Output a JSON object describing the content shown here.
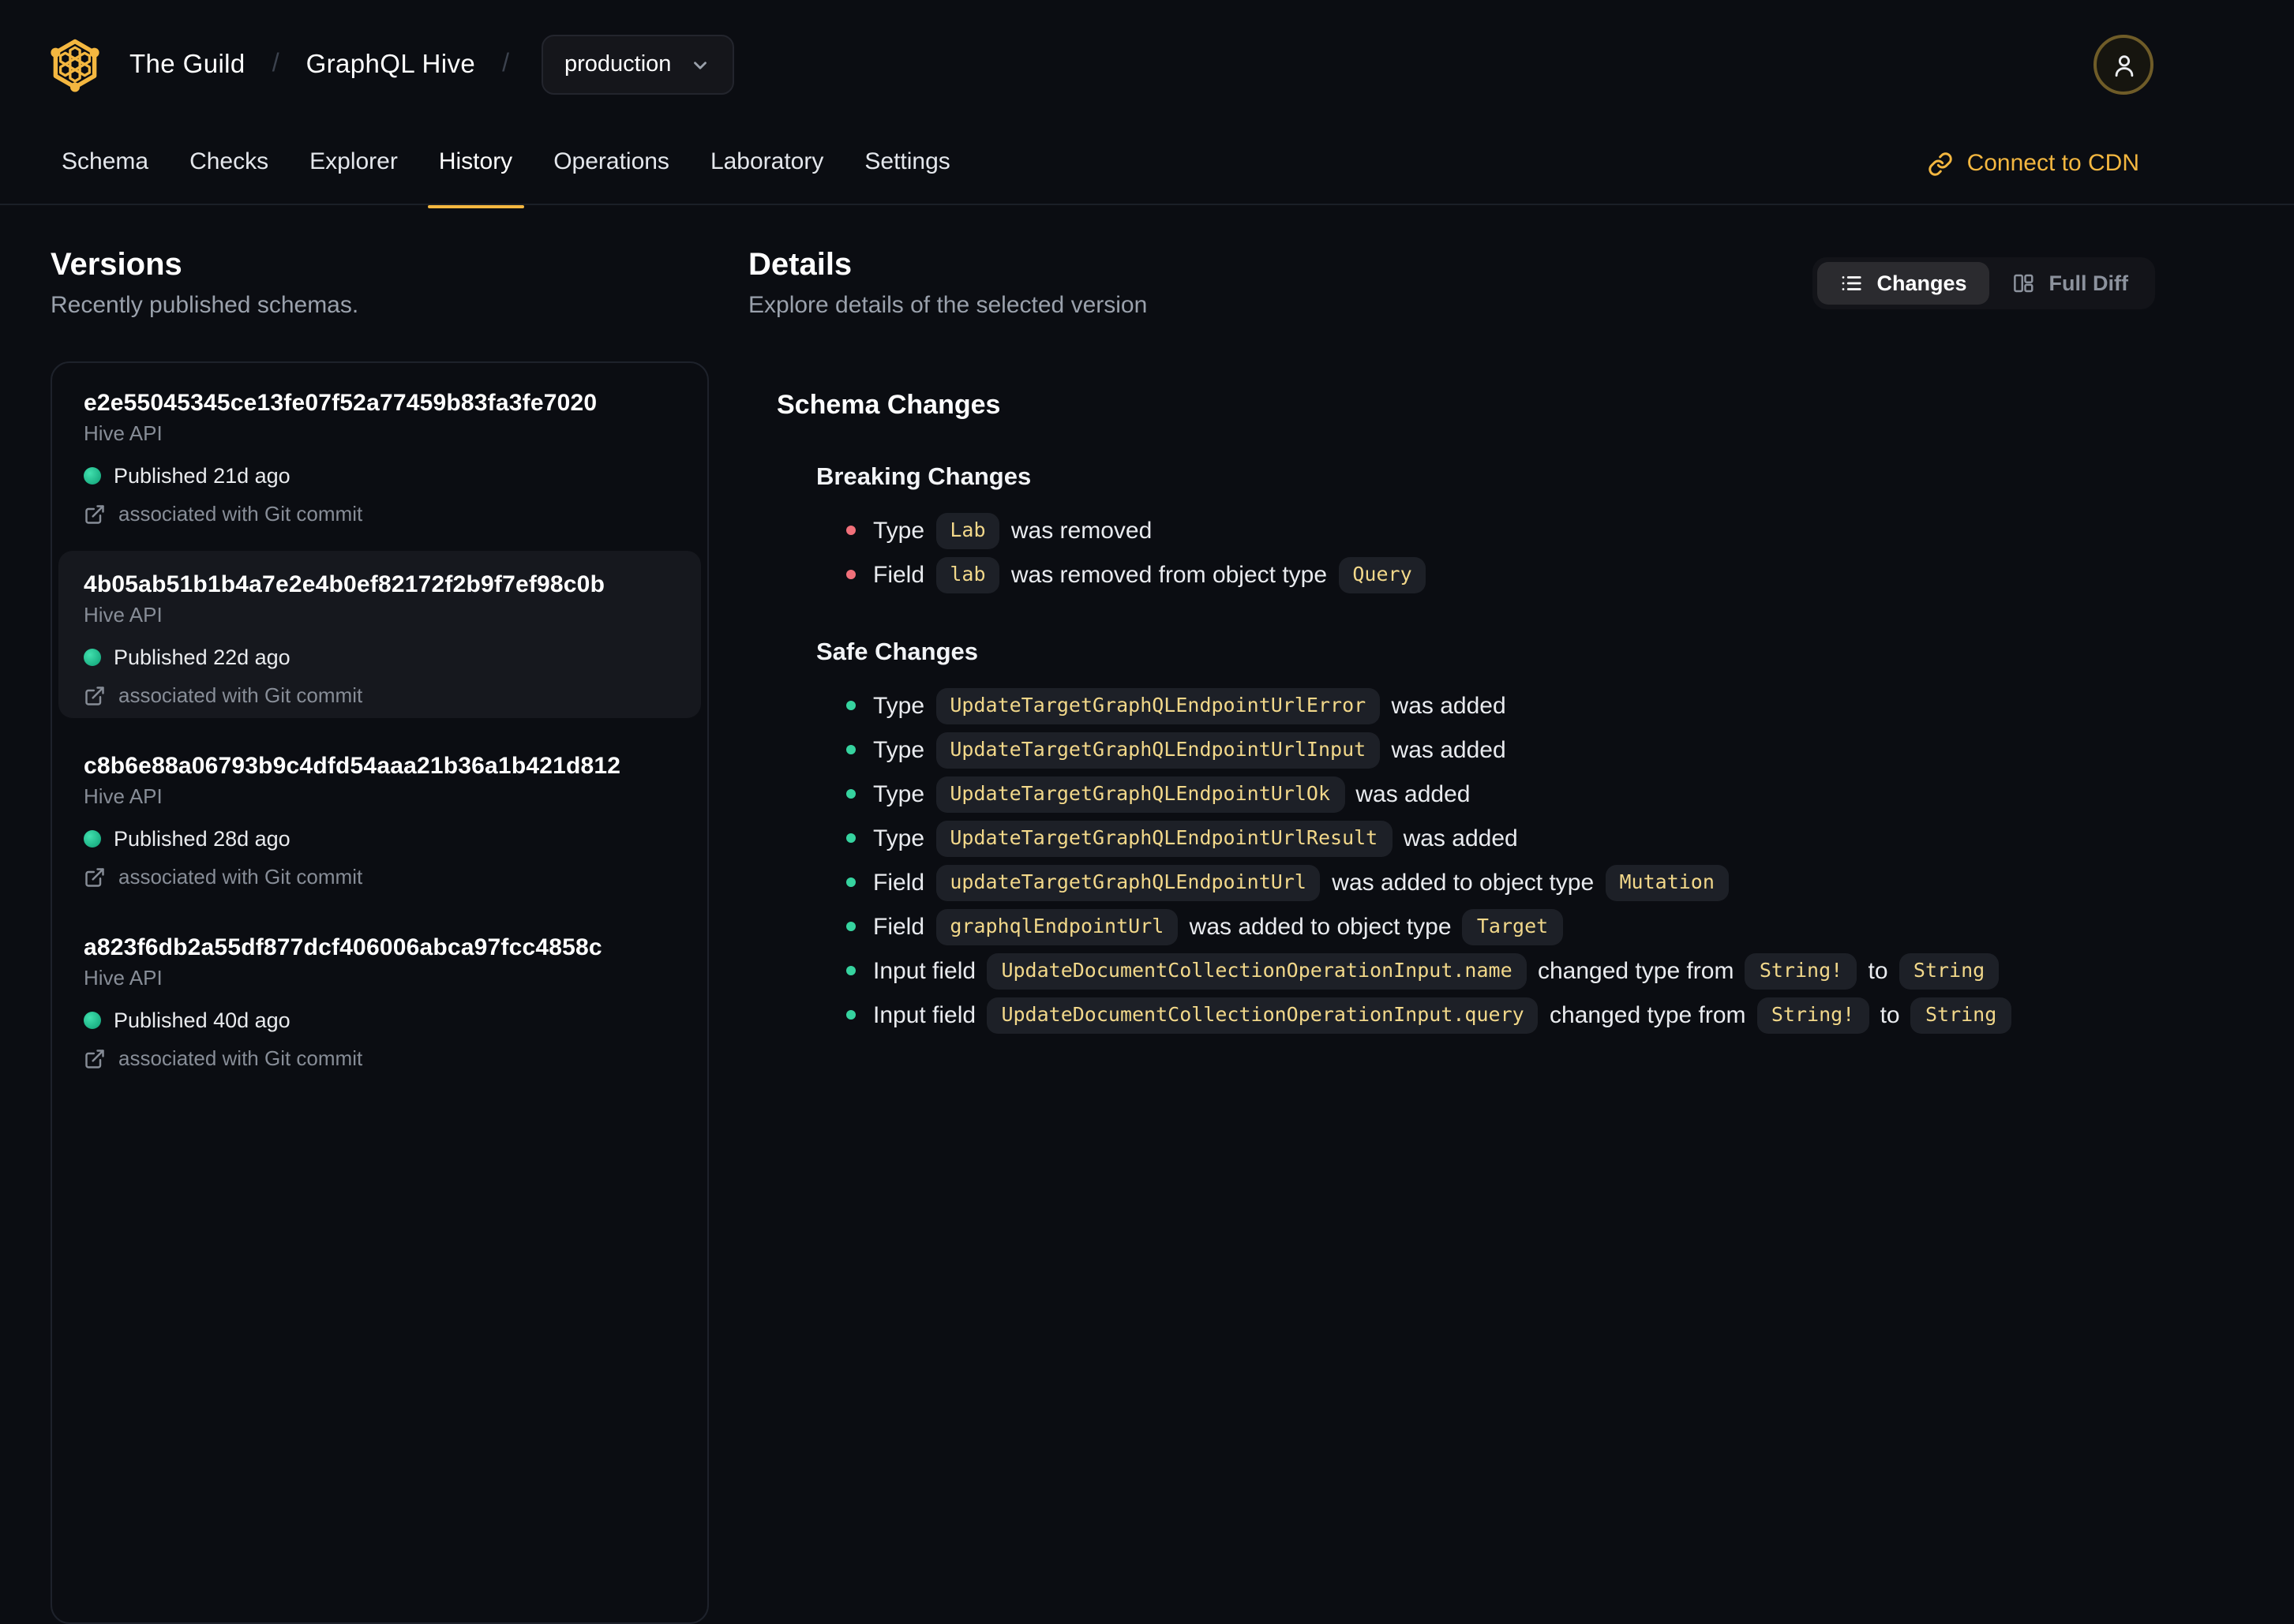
{
  "colors": {
    "accent": "#f4b740",
    "code_text": "#f2d88a",
    "breaking_bullet": "#f1707a",
    "safe_bullet": "#36d39f",
    "published_dot": "#10b981",
    "background": "#0b0d12"
  },
  "brand": {
    "org": "The Guild",
    "product": "GraphQL Hive",
    "environment": "production"
  },
  "nav": {
    "tabs": [
      {
        "label": "Schema",
        "active": false
      },
      {
        "label": "Checks",
        "active": false
      },
      {
        "label": "Explorer",
        "active": false
      },
      {
        "label": "History",
        "active": true
      },
      {
        "label": "Operations",
        "active": false
      },
      {
        "label": "Laboratory",
        "active": false
      },
      {
        "label": "Settings",
        "active": false
      }
    ],
    "cdn_link": "Connect to CDN"
  },
  "versions": {
    "title": "Versions",
    "subtitle": "Recently published schemas.",
    "items": [
      {
        "hash": "e2e55045345ce13fe07f52a77459b83fa3fe7020",
        "service": "Hive API",
        "published": "Published 21d ago",
        "git_note": "associated with Git commit",
        "selected": false
      },
      {
        "hash": "4b05ab51b1b4a7e2e4b0ef82172f2b9f7ef98c0b",
        "service": "Hive API",
        "published": "Published 22d ago",
        "git_note": "associated with Git commit",
        "selected": true
      },
      {
        "hash": "c8b6e88a06793b9c4dfd54aaa21b36a1b421d812",
        "service": "Hive API",
        "published": "Published 28d ago",
        "git_note": "associated with Git commit",
        "selected": false
      },
      {
        "hash": "a823f6db2a55df877dcf406006abca97fcc4858c",
        "service": "Hive API",
        "published": "Published 40d ago",
        "git_note": "associated with Git commit",
        "selected": false
      }
    ]
  },
  "details": {
    "title": "Details",
    "subtitle": "Explore details of the selected version",
    "view_toggle": {
      "changes": "Changes",
      "full_diff": "Full Diff"
    }
  },
  "schema_changes": {
    "title": "Schema Changes",
    "groups": [
      {
        "heading": "Breaking Changes",
        "severity": "breaking",
        "items": [
          [
            {
              "text": "Type "
            },
            {
              "code": "Lab"
            },
            {
              "text": " was removed"
            }
          ],
          [
            {
              "text": "Field "
            },
            {
              "code": "lab"
            },
            {
              "text": " was removed from object type "
            },
            {
              "code": "Query"
            }
          ]
        ]
      },
      {
        "heading": "Safe Changes",
        "severity": "safe",
        "items": [
          [
            {
              "text": "Type "
            },
            {
              "code": "UpdateTargetGraphQLEndpointUrlError"
            },
            {
              "text": " was added"
            }
          ],
          [
            {
              "text": "Type "
            },
            {
              "code": "UpdateTargetGraphQLEndpointUrlInput"
            },
            {
              "text": " was added"
            }
          ],
          [
            {
              "text": "Type "
            },
            {
              "code": "UpdateTargetGraphQLEndpointUrlOk"
            },
            {
              "text": " was added"
            }
          ],
          [
            {
              "text": "Type "
            },
            {
              "code": "UpdateTargetGraphQLEndpointUrlResult"
            },
            {
              "text": " was added"
            }
          ],
          [
            {
              "text": "Field "
            },
            {
              "code": "updateTargetGraphQLEndpointUrl"
            },
            {
              "text": " was added to object type "
            },
            {
              "code": "Mutation"
            }
          ],
          [
            {
              "text": "Field "
            },
            {
              "code": "graphqlEndpointUrl"
            },
            {
              "text": " was added to object type "
            },
            {
              "code": "Target"
            }
          ],
          [
            {
              "text": "Input field "
            },
            {
              "code": "UpdateDocumentCollectionOperationInput.name"
            },
            {
              "text": " changed type from "
            },
            {
              "code": "String!"
            },
            {
              "text": " to "
            },
            {
              "code": "String"
            }
          ],
          [
            {
              "text": "Input field "
            },
            {
              "code": "UpdateDocumentCollectionOperationInput.query"
            },
            {
              "text": " changed type from "
            },
            {
              "code": "String!"
            },
            {
              "text": " to "
            },
            {
              "code": "String"
            }
          ]
        ]
      }
    ]
  }
}
